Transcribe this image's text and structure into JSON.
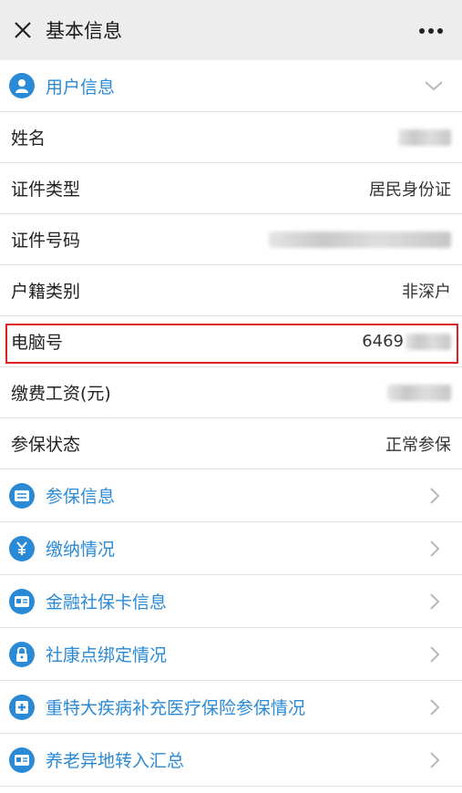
{
  "header": {
    "title": "基本信息"
  },
  "user_section": {
    "label": "用户信息"
  },
  "fields": [
    {
      "label": "姓名",
      "value": ""
    },
    {
      "label": "证件类型",
      "value": "居民身份证"
    },
    {
      "label": "证件号码",
      "value": ""
    },
    {
      "label": "户籍类别",
      "value": "非深户"
    },
    {
      "label": "电脑号",
      "value": "6469"
    },
    {
      "label": "缴费工资(元)",
      "value": ""
    },
    {
      "label": "参保状态",
      "value": "正常参保"
    }
  ],
  "menu": [
    {
      "label": "参保信息",
      "icon": "list-icon"
    },
    {
      "label": "缴纳情况",
      "icon": "yuan-icon"
    },
    {
      "label": "金融社保卡信息",
      "icon": "card-icon"
    },
    {
      "label": "社康点绑定情况",
      "icon": "lock-icon"
    },
    {
      "label": "重特大疾病补充医疗保险参保情况",
      "icon": "medical-plus-icon"
    },
    {
      "label": "养老异地转入汇总",
      "icon": "card-icon"
    }
  ],
  "colors": {
    "accent": "#2a8ad6",
    "highlight": "#e02020",
    "header_bg": "#ededed"
  }
}
